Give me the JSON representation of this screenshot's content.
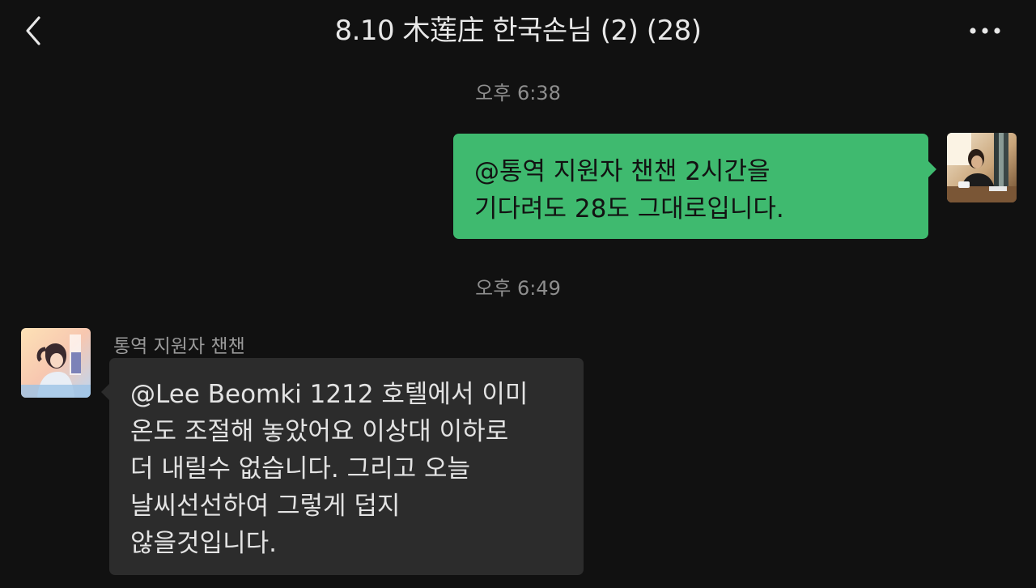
{
  "header": {
    "title": "8.10 木莲庄 한국손님 (2) (28)",
    "back_icon": "chevron-left-icon",
    "more_icon": "more-dots-icon"
  },
  "messages": [
    {
      "timestamp": "오후 6:38",
      "direction": "outgoing",
      "lines": [
        "@통역 지원자 챈챈  2시간을",
        "기다려도 28도 그대로입니다."
      ],
      "bubble_color": "#3fba6f"
    },
    {
      "timestamp": "오후 6:49",
      "direction": "incoming",
      "sender": "통역 지원자 챈챈",
      "text": "@Lee Beomki 1212 호텔에서 이미\n온도 조절해 놓았어요  이상대 이하로\n더 내릴수 없습니다. 그리고 오늘\n날씨선선하여  그렇게 덥지\n않을것입니다.",
      "bubble_color": "#2c2c2c"
    }
  ],
  "colors": {
    "background": "#111111",
    "accent_green": "#3fba6f",
    "incoming_bubble": "#2c2c2c",
    "muted_text": "#8e8e8e"
  }
}
